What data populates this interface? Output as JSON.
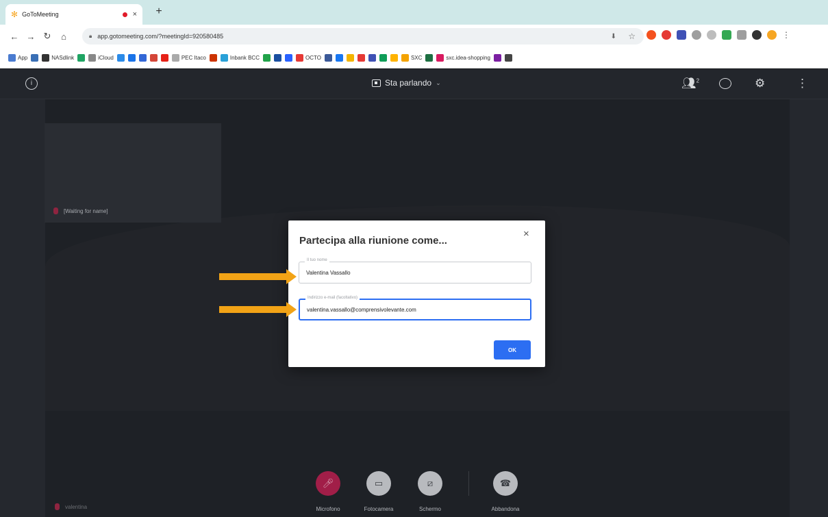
{
  "browser": {
    "tab_title": "GoToMeeting",
    "tab_close": "×",
    "new_tab": "+",
    "url": "app.gotomeeting.com/?meetingId=920580485",
    "bookmarks": [
      {
        "label": "App",
        "color": "#4a7bd0"
      },
      {
        "label": "",
        "color": "#3a6fb5"
      },
      {
        "label": "NASdlink",
        "color": "#333333"
      },
      {
        "label": "",
        "color": "#1fa463"
      },
      {
        "label": "iCloud",
        "color": "#888888"
      },
      {
        "label": "",
        "color": "#2c8be8"
      },
      {
        "label": "",
        "color": "#1a73e8"
      },
      {
        "label": "",
        "color": "#3367d6"
      },
      {
        "label": "",
        "color": "#d44638"
      },
      {
        "label": "",
        "color": "#e62117"
      },
      {
        "label": "PEC Itaco",
        "color": "#aaaaaa"
      },
      {
        "label": "",
        "color": "#cc3300"
      },
      {
        "label": "Inbank BCC",
        "color": "#2aa1d8"
      },
      {
        "label": "",
        "color": "#22a34a"
      },
      {
        "label": "",
        "color": "#1a4fa0"
      },
      {
        "label": "",
        "color": "#2962ff"
      },
      {
        "label": "OCTO",
        "color": "#e53935"
      },
      {
        "label": "",
        "color": "#3b5998"
      },
      {
        "label": "",
        "color": "#1877f2"
      },
      {
        "label": "",
        "color": "#f4b400"
      },
      {
        "label": "",
        "color": "#e53935"
      },
      {
        "label": "",
        "color": "#3f51b5"
      },
      {
        "label": "",
        "color": "#0f9d58"
      },
      {
        "label": "",
        "color": "#ffb300"
      },
      {
        "label": "SXC",
        "color": "#f4a300"
      },
      {
        "label": "",
        "color": "#1d6f42"
      },
      {
        "label": "sxc.idea-shopping",
        "color": "#d81b60"
      },
      {
        "label": "",
        "color": "#7b1fa2"
      },
      {
        "label": "",
        "color": "#444444"
      }
    ]
  },
  "app": {
    "view_mode": "Sta parlando",
    "participants_count": "2",
    "waiting_label": "[Waiting for name]",
    "self_label": "valentina"
  },
  "dialog": {
    "title": "Partecipa alla riunione come...",
    "close": "×",
    "name_label": "Il tuo nome",
    "name_value": "Valentina Vassallo",
    "email_label": "Indirizzo e-mail (facoltativo)",
    "email_value": "valentina.vassallo@comprensivolevante.com",
    "ok": "OK"
  },
  "controls": {
    "mic": "Microfono",
    "camera": "Fotocamera",
    "screen": "Schermo",
    "leave": "Abbandona"
  },
  "colors": {
    "accent": "#2c6ef2",
    "mic_muted": "#a11e48",
    "annotation_arrow": "#f2a316"
  }
}
